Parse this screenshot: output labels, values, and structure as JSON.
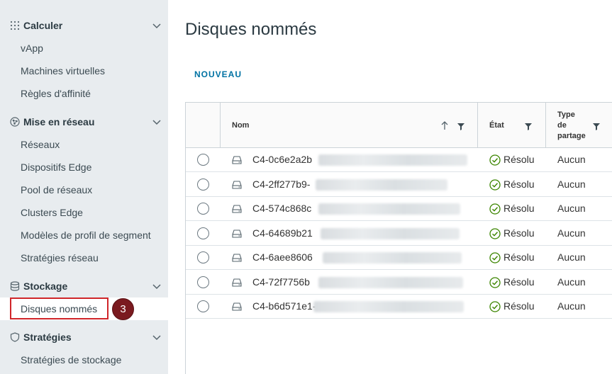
{
  "sidebar": {
    "groups": [
      {
        "title": "Calculer",
        "icon": "grid-dots-icon",
        "items": [
          "vApp",
          "Machines virtuelles",
          "Règles d'affinité"
        ]
      },
      {
        "title": "Mise en réseau",
        "icon": "network-icon",
        "items": [
          "Réseaux",
          "Dispositifs Edge",
          "Pool de réseaux",
          "Clusters Edge",
          "Modèles de profil de segment",
          "Stratégies réseau"
        ]
      },
      {
        "title": "Stockage",
        "icon": "database-icon",
        "items": [
          "Disques nommés"
        ]
      },
      {
        "title": "Stratégies",
        "icon": "shield-icon",
        "items": [
          "Stratégies de stockage"
        ]
      }
    ],
    "active_item": "Disques nommés",
    "step_badge": "3"
  },
  "main": {
    "title": "Disques nommés",
    "new_button": "NOUVEAU",
    "columns": {
      "name": "Nom",
      "state": "État",
      "share_type_line1": "Type",
      "share_type_line2": "de",
      "share_type_line3": "partage"
    },
    "rows": [
      {
        "name": "C4-0c6e2a2b",
        "state": "Résolu",
        "share": "Aucun"
      },
      {
        "name": "C4-2ff277b9-",
        "state": "Résolu",
        "share": "Aucun"
      },
      {
        "name": "C4-574c868c",
        "state": "Résolu",
        "share": "Aucun"
      },
      {
        "name": "C4-64689b21",
        "state": "Résolu",
        "share": "Aucun"
      },
      {
        "name": "C4-6aee8606",
        "state": "Résolu",
        "share": "Aucun"
      },
      {
        "name": "C4-72f7756b",
        "state": "Résolu",
        "share": "Aucun"
      },
      {
        "name": "C4-b6d571e1-",
        "state": "Résolu",
        "share": "Aucun"
      }
    ]
  },
  "colors": {
    "accent": "#0072a3",
    "highlight": "#d0262a",
    "badge": "#7a1a1f",
    "success": "#3c8500",
    "sidebar_bg": "#e8ecef"
  }
}
